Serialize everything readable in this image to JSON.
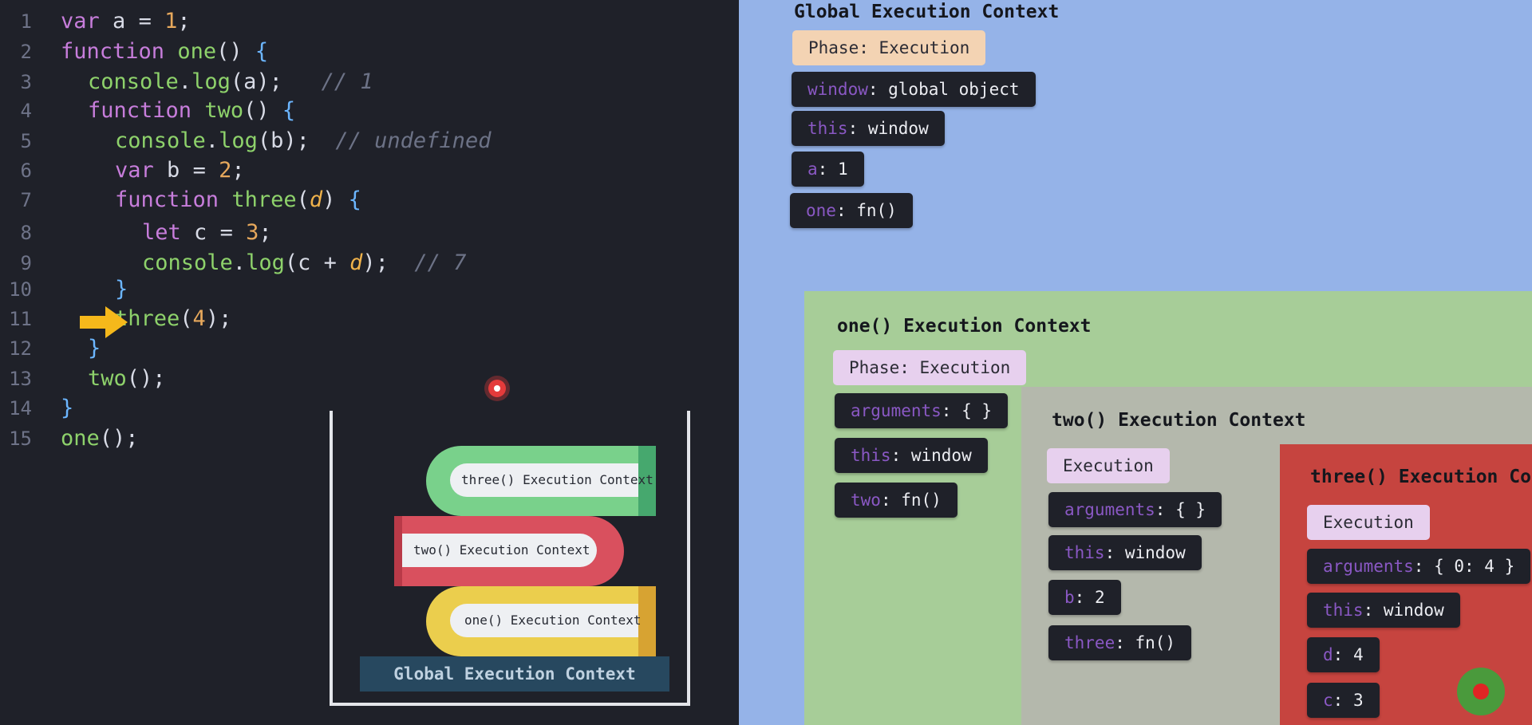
{
  "editor": {
    "lines": [
      {
        "n": "1",
        "tokens": [
          {
            "t": "var",
            "c": "kw"
          },
          {
            "t": " a ",
            "c": "id"
          },
          {
            "t": "=",
            "c": "pu"
          },
          {
            "t": " ",
            "c": "pu"
          },
          {
            "t": "1",
            "c": "num"
          },
          {
            "t": ";",
            "c": "pu"
          }
        ]
      },
      {
        "n": "2",
        "tokens": [
          {
            "t": "function",
            "c": "kw"
          },
          {
            "t": " ",
            "c": "pu"
          },
          {
            "t": "one",
            "c": "fn"
          },
          {
            "t": "()",
            "c": "pu"
          },
          {
            "t": " {",
            "c": "br"
          }
        ]
      },
      {
        "n": "3",
        "tokens": [
          {
            "t": "console",
            "c": "fn"
          },
          {
            "t": ".",
            "c": "pu"
          },
          {
            "t": "log",
            "c": "fn"
          },
          {
            "t": "(a);",
            "c": "pu"
          },
          {
            "t": "   // 1",
            "c": "cm"
          }
        ]
      },
      {
        "n": "4",
        "tokens": [
          {
            "t": "function",
            "c": "kw"
          },
          {
            "t": " ",
            "c": "pu"
          },
          {
            "t": "two",
            "c": "fn"
          },
          {
            "t": "()",
            "c": "pu"
          },
          {
            "t": " {",
            "c": "br"
          }
        ]
      },
      {
        "n": "5",
        "tokens": [
          {
            "t": "console",
            "c": "fn"
          },
          {
            "t": ".",
            "c": "pu"
          },
          {
            "t": "log",
            "c": "fn"
          },
          {
            "t": "(b);",
            "c": "pu"
          },
          {
            "t": "  // undefined",
            "c": "cm"
          }
        ]
      },
      {
        "n": "6",
        "tokens": [
          {
            "t": "var",
            "c": "kw"
          },
          {
            "t": " b ",
            "c": "id"
          },
          {
            "t": "=",
            "c": "pu"
          },
          {
            "t": " ",
            "c": "pu"
          },
          {
            "t": "2",
            "c": "num"
          },
          {
            "t": ";",
            "c": "pu"
          }
        ]
      },
      {
        "n": "7",
        "tokens": [
          {
            "t": "function",
            "c": "kw"
          },
          {
            "t": " ",
            "c": "pu"
          },
          {
            "t": "three",
            "c": "fn"
          },
          {
            "t": "(",
            "c": "pu"
          },
          {
            "t": "d",
            "c": "par"
          },
          {
            "t": ")",
            "c": "pu"
          },
          {
            "t": " {",
            "c": "br"
          }
        ]
      },
      {
        "n": "8",
        "tokens": [
          {
            "t": "let",
            "c": "kw"
          },
          {
            "t": " c ",
            "c": "id"
          },
          {
            "t": "=",
            "c": "pu"
          },
          {
            "t": " ",
            "c": "pu"
          },
          {
            "t": "3",
            "c": "num"
          },
          {
            "t": ";",
            "c": "pu"
          }
        ]
      },
      {
        "n": "9",
        "tokens": [
          {
            "t": "console",
            "c": "fn"
          },
          {
            "t": ".",
            "c": "pu"
          },
          {
            "t": "log",
            "c": "fn"
          },
          {
            "t": "(c + ",
            "c": "pu"
          },
          {
            "t": "d",
            "c": "par"
          },
          {
            "t": ");",
            "c": "pu"
          },
          {
            "t": "  // 7",
            "c": "cm"
          }
        ]
      },
      {
        "n": "10",
        "tokens": [
          {
            "t": "}",
            "c": "br"
          }
        ]
      },
      {
        "n": "11",
        "tokens": [
          {
            "t": "three",
            "c": "fn"
          },
          {
            "t": "(",
            "c": "pu"
          },
          {
            "t": "4",
            "c": "num"
          },
          {
            "t": ");",
            "c": "pu"
          }
        ]
      },
      {
        "n": "12",
        "tokens": [
          {
            "t": "}",
            "c": "br"
          }
        ]
      },
      {
        "n": "13",
        "tokens": [
          {
            "t": "two",
            "c": "fn"
          },
          {
            "t": "();",
            "c": "pu"
          }
        ]
      },
      {
        "n": "14",
        "tokens": [
          {
            "t": "}",
            "c": "br"
          }
        ]
      },
      {
        "n": "15",
        "tokens": [
          {
            "t": "one",
            "c": "fn"
          },
          {
            "t": "();",
            "c": "pu"
          }
        ]
      }
    ],
    "indent_levels": [
      0,
      0,
      1,
      1,
      2,
      2,
      2,
      3,
      3,
      2,
      2,
      1,
      1,
      0,
      0
    ],
    "current_line": "9"
  },
  "call_stack": {
    "three": "three() Execution Context",
    "two": "two() Execution Context",
    "one": "one() Execution Context",
    "global": "Global Execution Context"
  },
  "contexts": {
    "global": {
      "title": "Global Execution Context",
      "phase_key": "Phase:",
      "phase_value": " Execution",
      "vars": [
        {
          "k": "window",
          "v": ": global object"
        },
        {
          "k": "this",
          "v": ": window"
        },
        {
          "k": "a",
          "v": ": 1"
        },
        {
          "k": "one",
          "v": ": fn()"
        }
      ]
    },
    "one": {
      "title": "one() Execution Context",
      "phase_key": "Phase:",
      "phase_value": " Execution",
      "vars": [
        {
          "k": "arguments",
          "v": ": { }"
        },
        {
          "k": "this",
          "v": ": window"
        },
        {
          "k": "two",
          "v": ": fn()"
        }
      ]
    },
    "two": {
      "title": "two() Execution Context",
      "phase": "Execution",
      "vars": [
        {
          "k": "arguments",
          "v": ": { }"
        },
        {
          "k": "this",
          "v": ": window"
        },
        {
          "k": "b",
          "v": ": 2"
        },
        {
          "k": "three",
          "v": ": fn()"
        }
      ]
    },
    "three": {
      "title": "three() Execution Co",
      "phase": "Execution",
      "vars": [
        {
          "k": "arguments",
          "v": ": { 0: 4 }"
        },
        {
          "k": "this",
          "v": ": window"
        },
        {
          "k": "d",
          "v": ": 4"
        },
        {
          "k": "c",
          "v": ": 3"
        }
      ]
    }
  },
  "colors": {
    "global_bg": "#95b3e8",
    "one_bg": "#a7cd98",
    "two_bg": "#b4b8ac",
    "three_bg": "#c6443f",
    "phase_global": "#f3d3b3",
    "phase_one": "#e7d0ee",
    "arrow": "#f5b81b"
  },
  "icons": {
    "current_line_arrow": "arrow-right-icon",
    "cursor": "cursor-dot-icon",
    "record": "record-button-icon"
  }
}
